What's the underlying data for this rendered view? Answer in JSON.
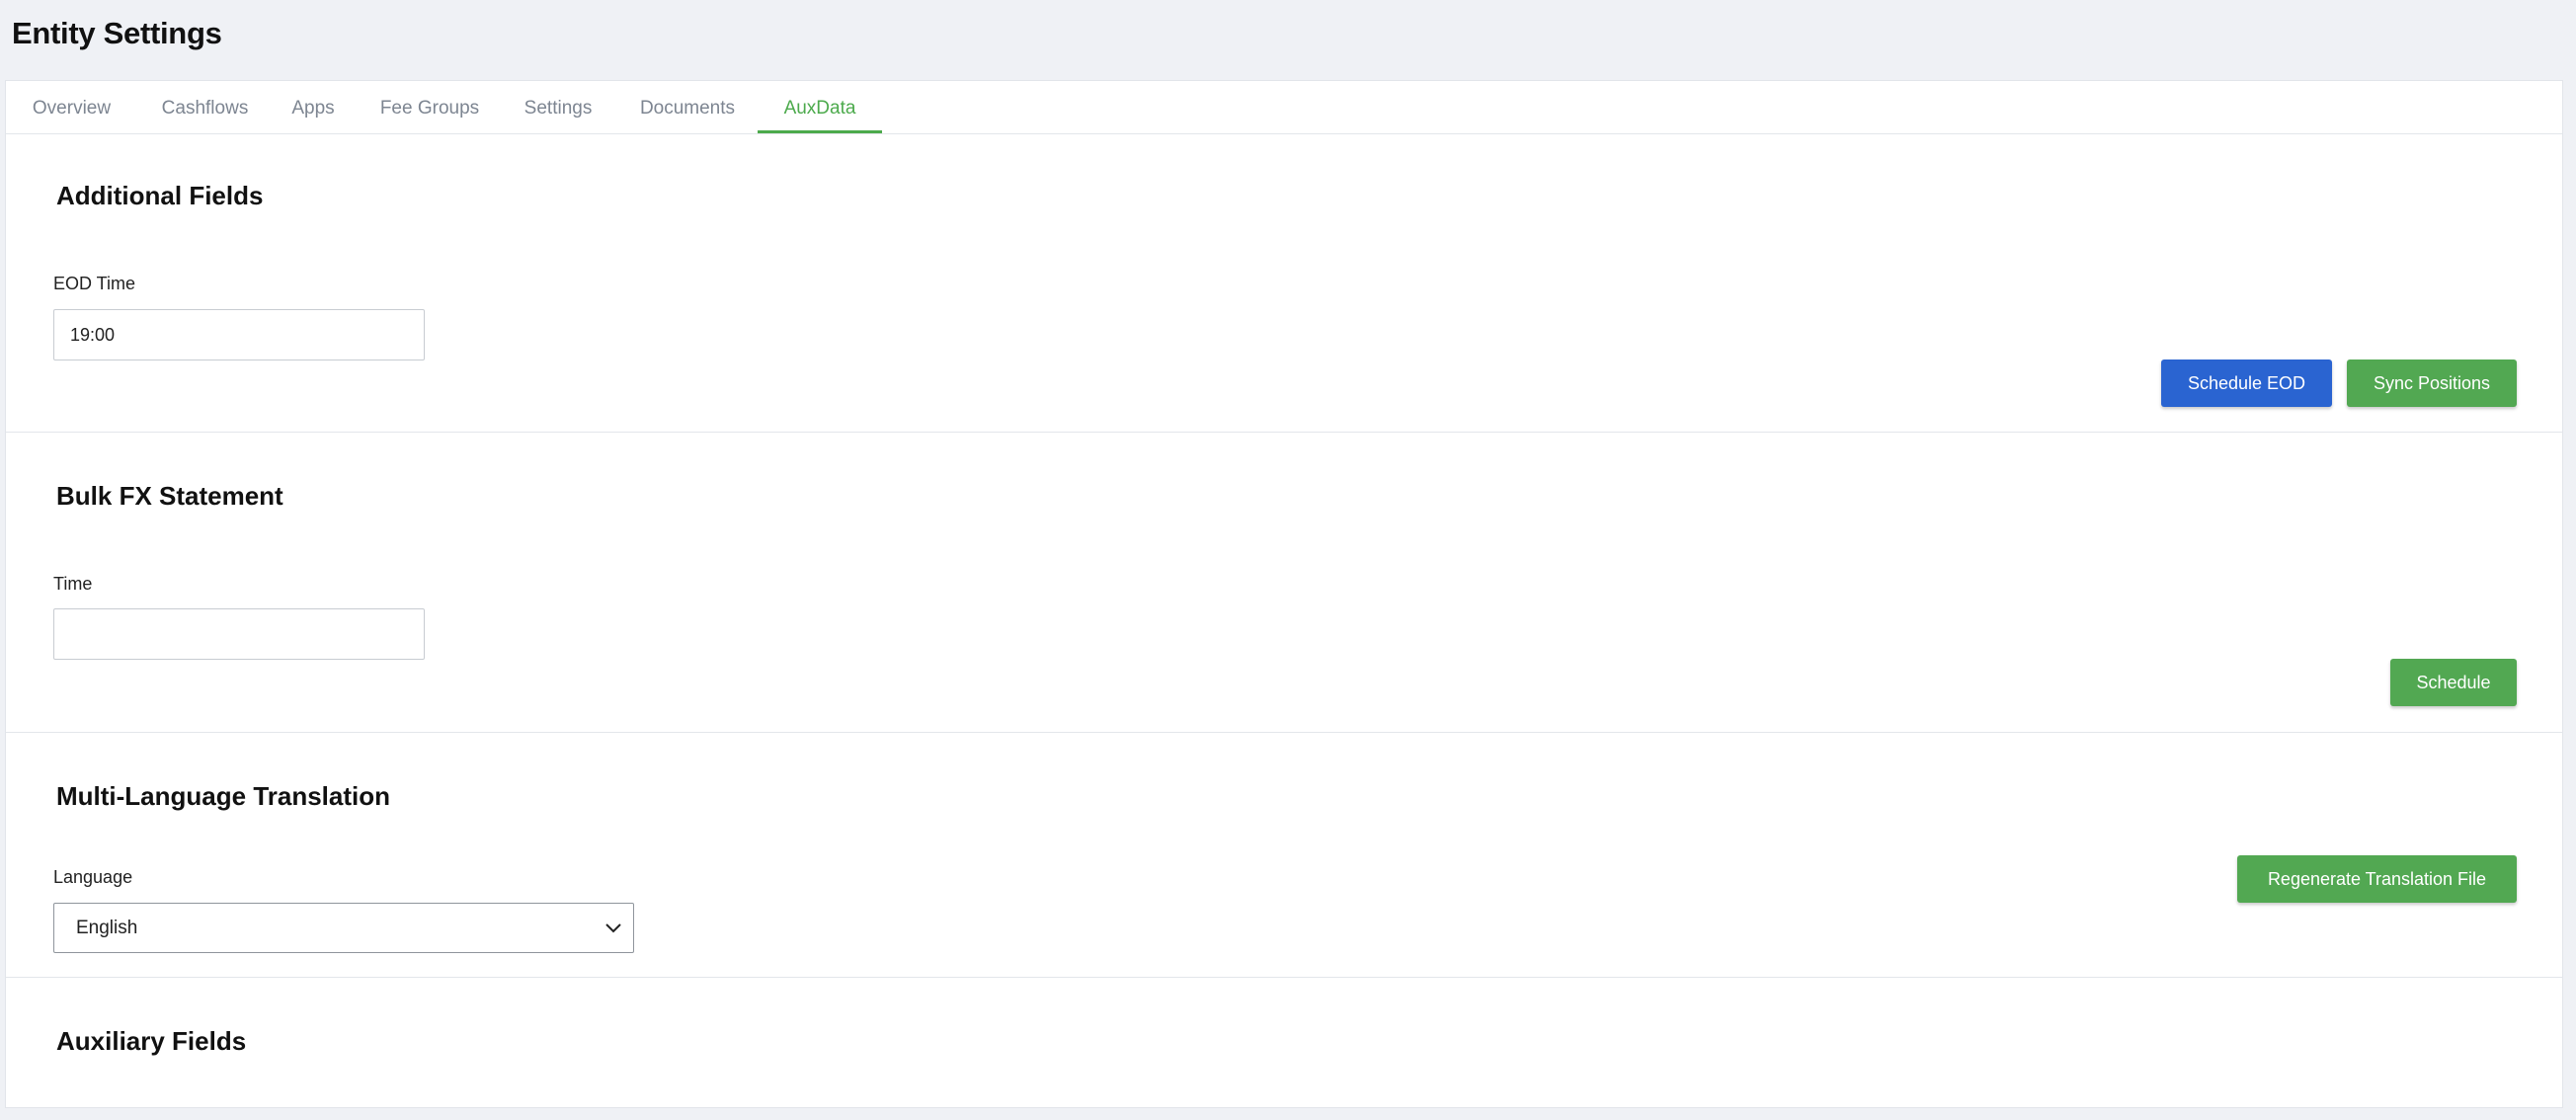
{
  "page": {
    "title": "Entity Settings"
  },
  "colors": {
    "accent_green": "#4caa4c",
    "primary_blue": "#2a64d1",
    "button_green": "#52a852",
    "inactive_tab": "#7d8591",
    "background": "#eff1f5"
  },
  "tabs": [
    {
      "label": "Overview",
      "active": false
    },
    {
      "label": "Cashflows",
      "active": false
    },
    {
      "label": "Apps",
      "active": false
    },
    {
      "label": "Fee Groups",
      "active": false
    },
    {
      "label": "Settings",
      "active": false
    },
    {
      "label": "Documents",
      "active": false
    },
    {
      "label": "AuxData",
      "active": true
    }
  ],
  "additional_fields": {
    "title": "Additional Fields",
    "eod_label": "EOD Time",
    "eod_value": "19:00",
    "schedule_eod_label": "Schedule EOD",
    "sync_positions_label": "Sync Positions"
  },
  "bulk_fx": {
    "title": "Bulk FX Statement",
    "time_label": "Time",
    "time_value": "",
    "schedule_label": "Schedule"
  },
  "translation": {
    "title": "Multi-Language Translation",
    "language_label": "Language",
    "language_value": "English",
    "regenerate_label": "Regenerate Translation File",
    "chevron_icon": "chevron-down-icon"
  },
  "auxiliary": {
    "title": "Auxiliary Fields"
  }
}
